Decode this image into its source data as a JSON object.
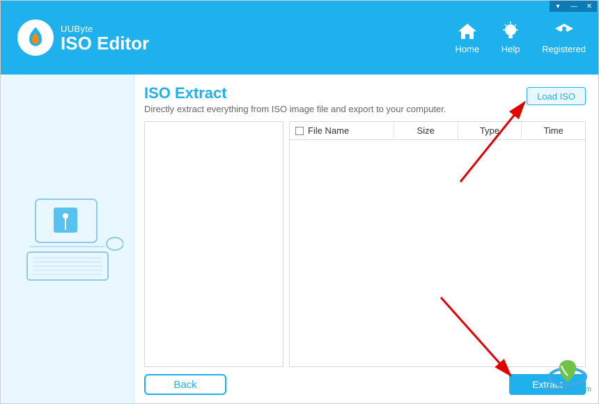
{
  "app": {
    "brand": "UUByte",
    "title": "ISO Editor"
  },
  "nav": {
    "home": "Home",
    "help": "Help",
    "registered": "Registered"
  },
  "main": {
    "title": "ISO Extract",
    "subtitle": "Directly extract everything from ISO image file and export to your computer.",
    "load_btn": "Load ISO",
    "columns": {
      "file": "File Name",
      "size": "Size",
      "type": "Type",
      "time": "Time"
    },
    "back_btn": "Back",
    "extract_btn": "Extract"
  },
  "watermark": {
    "url": "www.xz7.com"
  }
}
